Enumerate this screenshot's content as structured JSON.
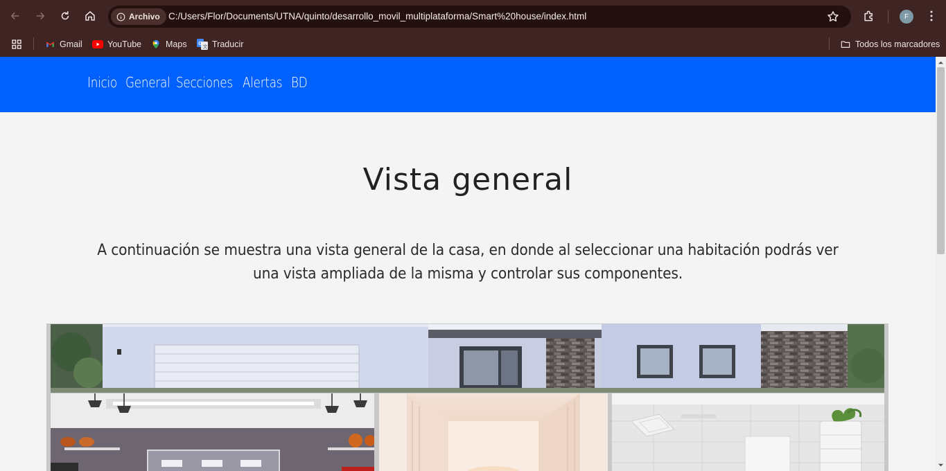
{
  "browser": {
    "chip_label": "Archivo",
    "url": "C:/Users/Flor/Documents/UTNA/quinto/desarrollo_movil_multiplataforma/Smart%20house/index.html",
    "profile_initial": "F",
    "bookmarks": [
      {
        "label": "Gmail",
        "icon": "gmail-icon"
      },
      {
        "label": "YouTube",
        "icon": "youtube-icon"
      },
      {
        "label": "Maps",
        "icon": "maps-icon"
      },
      {
        "label": "Traducir",
        "icon": "translate-icon"
      }
    ],
    "all_bookmarks_label": "Todos los marcadores"
  },
  "nav": {
    "items": [
      "Inicio",
      "General",
      "Secciones",
      "Alertas",
      "BD"
    ],
    "background": "#0061fe"
  },
  "main": {
    "title": "Vista general",
    "intro": "A continuación se muestra una vista general de la casa, en donde al seleccionar una habitación podrás ver una vista ampliada de la misma y controlar sus componentes."
  },
  "map": {
    "areas": [
      "house-facade",
      "garage",
      "hallway",
      "bathroom"
    ]
  }
}
